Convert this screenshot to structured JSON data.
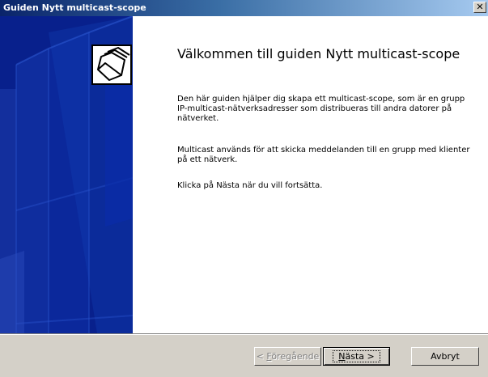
{
  "window": {
    "title": "Guiden Nytt multicast-scope",
    "close_glyph": "✕"
  },
  "main": {
    "heading": "Välkommen till guiden Nytt multicast-scope",
    "paragraphs": [
      "Den här guiden hjälper dig skapa ett multicast-scope, som är en grupp IP-multicast-nätverksadresser som distribueras till andra datorer på nätverket.",
      "Multicast används för att skicka meddelanden till en grupp med klienter på ett nätverk.",
      "Klicka på Nästa när du vill fortsätta."
    ]
  },
  "buttons": {
    "back": {
      "prefix": "< ",
      "accel": "F",
      "rest": "öregående"
    },
    "next": {
      "accel": "N",
      "rest": "ästa >"
    },
    "cancel": "Avbryt"
  },
  "icons": {
    "banner": "folders-icon",
    "close": "close-icon"
  },
  "colors": {
    "title_start": "#0a246a",
    "title_end": "#a6caf0",
    "banner": "#08208c",
    "face": "#d4d0c8"
  }
}
